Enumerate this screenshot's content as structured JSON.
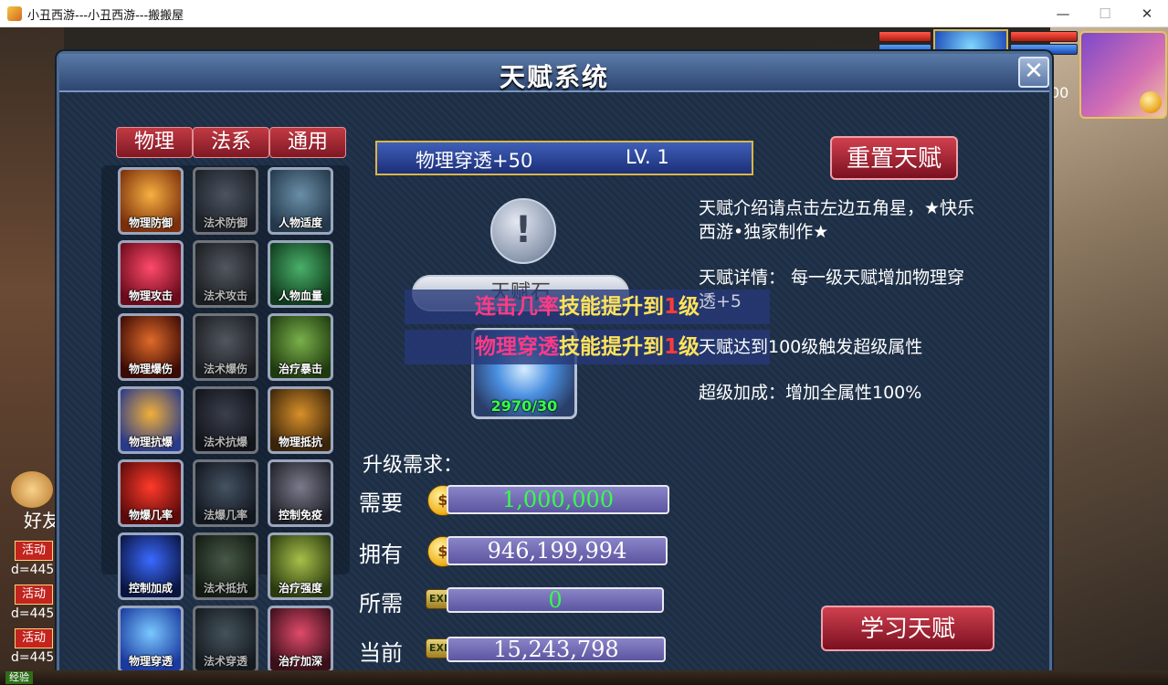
{
  "window": {
    "title": "小丑西游---小丑西游---搬搬屋",
    "minimize": "—",
    "maximize": "☐",
    "close": "✕"
  },
  "hud": {
    "left_icon_label": "好友",
    "activity_badges": [
      "活动",
      "活动",
      "活动"
    ],
    "coord_texts": [
      "d=4457",
      "d=4457",
      "d=4457"
    ],
    "right_partial_text": "00",
    "exp_label": "经验"
  },
  "panel": {
    "title": "天赋系统",
    "close_glyph": "✕",
    "tabs": [
      "物理",
      "法系",
      "通用"
    ],
    "skills": [
      {
        "label": "物理防御"
      },
      {
        "label": "法术防御"
      },
      {
        "label": "人物适度"
      },
      {
        "label": "物理攻击"
      },
      {
        "label": "法术攻击"
      },
      {
        "label": "人物血量"
      },
      {
        "label": "物理爆伤"
      },
      {
        "label": "法术爆伤"
      },
      {
        "label": "治疗暴击"
      },
      {
        "label": "物理抗爆"
      },
      {
        "label": "法术抗爆"
      },
      {
        "label": "物理抵抗"
      },
      {
        "label": "物爆几率"
      },
      {
        "label": "法爆几率"
      },
      {
        "label": "控制免疫"
      },
      {
        "label": "控制加成"
      },
      {
        "label": "法术抵抗"
      },
      {
        "label": "治疗强度"
      },
      {
        "label": "物理穿透"
      },
      {
        "label": "法术穿透"
      },
      {
        "label": "治疗加深"
      }
    ],
    "selected": {
      "name": "物理穿透+50",
      "level": "LV. 1",
      "info_glyph": "!",
      "pill_text": "天赋石",
      "count": "2970/30"
    },
    "reset_button": "重置天赋",
    "learn_button": "学习天赋",
    "notices": [
      {
        "a": "连击几率",
        "b": "技能提升到",
        "c": "1",
        "d": "级"
      },
      {
        "a": "物理穿透",
        "b": "技能提升到",
        "c": "1",
        "d": "级"
      }
    ],
    "description": {
      "intro_line1": "天赋介绍请点击左边五角星，★快乐",
      "intro_line2": "西游•独家制作★",
      "detail_line1": "天赋详情：  每一级天赋增加物理穿",
      "detail_line2": "透+5",
      "trigger": "天赋达到100级触发超级属性",
      "super": "超级加成：增加全属性100%"
    },
    "requirements": {
      "title": "升级需求：",
      "rows": [
        {
          "label": "需要",
          "icon": "gold",
          "value": "1,000,000",
          "color": "#35ff4a"
        },
        {
          "label": "拥有",
          "icon": "gold",
          "value": "946,199,994",
          "color": "#ffffff"
        },
        {
          "label": "所需",
          "icon": "exp",
          "value": "0",
          "color": "#35ff4a"
        },
        {
          "label": "当前",
          "icon": "exp",
          "value": "15,243,798",
          "color": "#ffffff"
        }
      ],
      "gold_glyph": "$",
      "exp_glyph": "EXP"
    }
  }
}
